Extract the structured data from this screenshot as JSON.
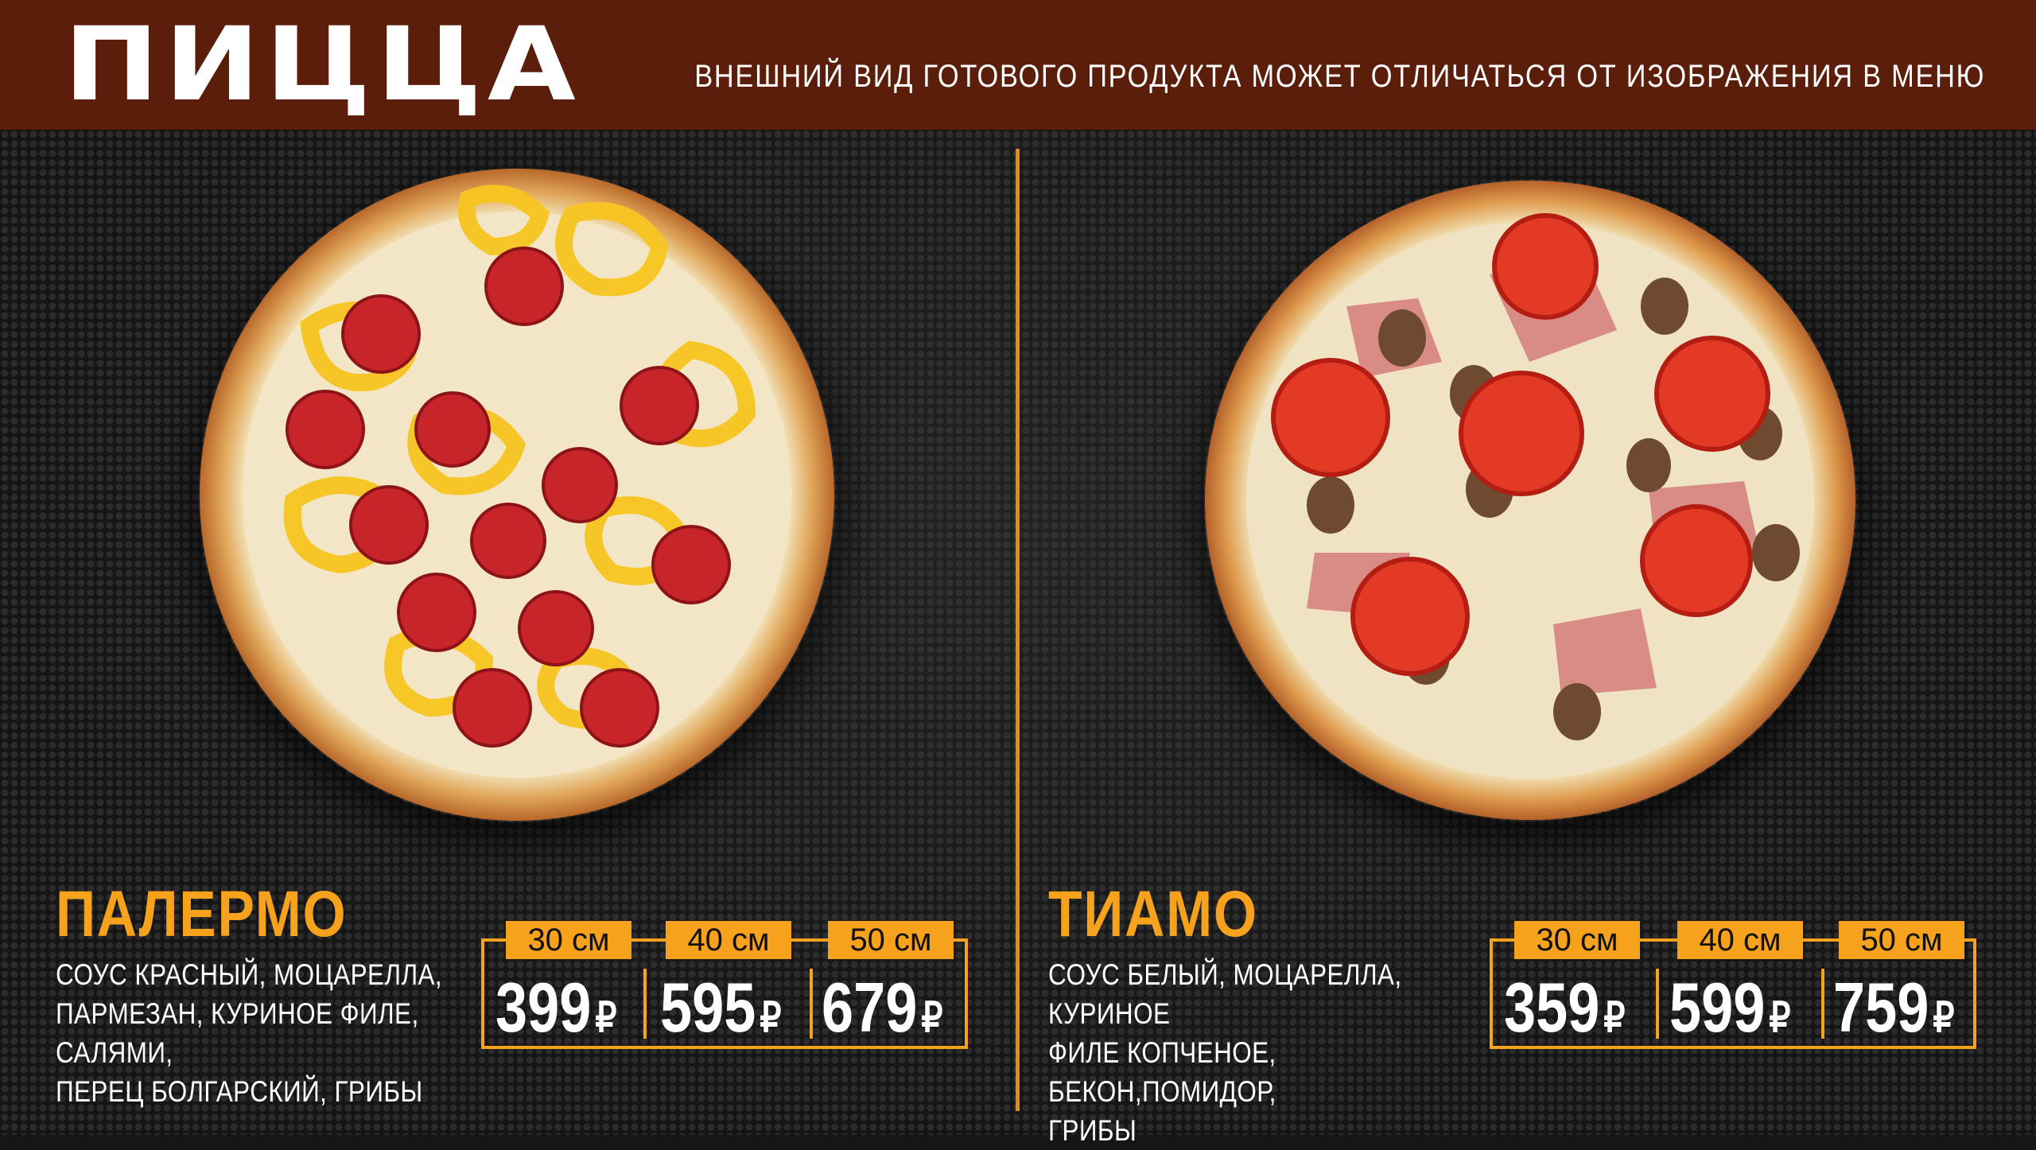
{
  "header": {
    "title": "ПИЦЦА",
    "disclaimer": "ВНЕШНИЙ ВИД ГОТОВОГО ПРОДУКТА МОЖЕТ ОТЛИЧАТЬСЯ ОТ ИЗОБРАЖЕНИЯ В МЕНЮ"
  },
  "colors": {
    "header_bg": "#5a1e0b",
    "accent": "#f6a21c",
    "background": "#161616"
  },
  "currency": "₽",
  "pizzas": [
    {
      "name": "ПАЛЕРМО",
      "description_lines": [
        "СОУС КРАСНЫЙ, МОЦАРЕЛЛА,",
        "ПАРМЕЗАН, КУРИНОЕ ФИЛЕ, САЛЯМИ,",
        "ПЕРЕЦ БОЛГАРСКИЙ, ГРИБЫ"
      ],
      "image": "pizza-palermo-photo",
      "prices": [
        {
          "size": "30 см",
          "price": "399"
        },
        {
          "size": "40 см",
          "price": "595"
        },
        {
          "size": "50 см",
          "price": "679"
        }
      ]
    },
    {
      "name": "ТИАМО",
      "description_lines": [
        "СОУС БЕЛЫЙ, МОЦАРЕЛЛА, КУРИНОЕ",
        "ФИЛЕ КОПЧЕНОЕ, БЕКОН,ПОМИДОР,",
        "ГРИБЫ"
      ],
      "image": "pizza-tiamo-photo",
      "prices": [
        {
          "size": "30 см",
          "price": "359"
        },
        {
          "size": "40 см",
          "price": "599"
        },
        {
          "size": "50 см",
          "price": "759"
        }
      ]
    }
  ]
}
